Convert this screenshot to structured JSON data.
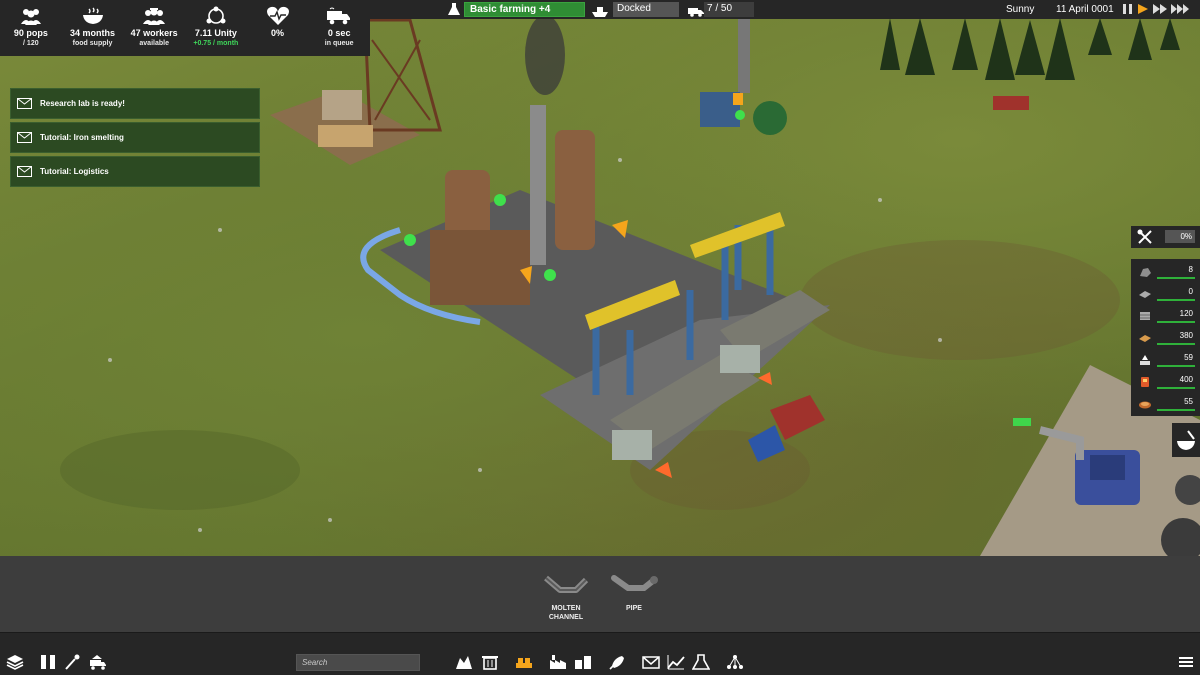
{
  "stats": [
    {
      "icon": "population-icon",
      "value": "90 pops",
      "sub": "/ 120",
      "sub_color": "white"
    },
    {
      "icon": "food-bowl-icon",
      "value": "34 months",
      "sub": "food supply",
      "sub_color": "white"
    },
    {
      "icon": "workers-icon",
      "value": "47 workers",
      "sub": "available",
      "sub_color": "white"
    },
    {
      "icon": "unity-icon",
      "value": "7.11 Unity",
      "sub": "+0.75 / month",
      "sub_color": "green"
    },
    {
      "icon": "health-heart-icon",
      "value": "0%",
      "sub": "",
      "sub_color": "white"
    },
    {
      "icon": "delivery-truck-icon",
      "value": "0 sec",
      "sub": "in queue",
      "sub_color": "white"
    }
  ],
  "research": {
    "label": "Basic farming +4"
  },
  "dock": {
    "status": "Docked"
  },
  "vehicles": {
    "count": "7 / 50"
  },
  "clock": {
    "weather": "Sunny",
    "date": "11 April 0001"
  },
  "speed_controls": [
    "pause-icon",
    "play-icon",
    "fast-forward-icon",
    "fastest-forward-icon"
  ],
  "notifications": [
    {
      "text": "Research lab is ready!"
    },
    {
      "text": "Tutorial: Iron smelting"
    },
    {
      "text": "Tutorial: Logistics"
    }
  ],
  "maintenance": {
    "value": "0%"
  },
  "resources": [
    {
      "icon": "iron-ore-icon",
      "value": "8"
    },
    {
      "icon": "iron-plate-icon",
      "value": "0"
    },
    {
      "icon": "construction-parts-icon",
      "value": "120"
    },
    {
      "icon": "wood-planks-icon",
      "value": "380"
    },
    {
      "icon": "fertilizer-icon",
      "value": "59"
    },
    {
      "icon": "fuel-canister-icon",
      "value": "400"
    },
    {
      "icon": "food-icon",
      "value": "55"
    }
  ],
  "toolbox": {
    "items": [
      {
        "label_line1": "MOLTEN",
        "label_line2": "CHANNEL"
      },
      {
        "label_line1": "PIPE",
        "label_line2": ""
      }
    ]
  },
  "bottom_bar": {
    "search_placeholder": "Search",
    "left_icons": [
      "layers-icon",
      "pause-menu-icon",
      "eyedropper-icon",
      "vehicle-depot-icon"
    ],
    "category_icons": [
      "demolish-icon",
      "trash-icon",
      "conveyor-icon",
      "factory-icon",
      "buildings-icon",
      "rocket-icon",
      "mail-icon",
      "stats-chart-icon",
      "research-flask-icon",
      "tech-tree-icon"
    ],
    "menu_icon": "hamburger-menu-icon"
  },
  "colors": {
    "panel": "#262626",
    "accent_green": "#2f8d34",
    "notif_green": "#2c4a22",
    "toolbox": "#3d3d3d"
  }
}
